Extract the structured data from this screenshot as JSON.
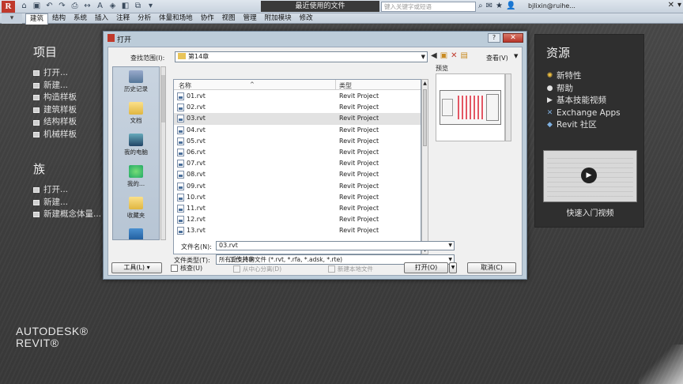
{
  "titlebar": {
    "doc_title": "最近使用的文件",
    "search_placeholder": "键入关键字或短语",
    "username": "bjlixin@ruihe..."
  },
  "ribbon": {
    "app_button": "▾",
    "tabs": [
      "建筑",
      "结构",
      "系统",
      "插入",
      "注释",
      "分析",
      "体量和场地",
      "协作",
      "视图",
      "管理",
      "附加模块",
      "修改"
    ]
  },
  "left": {
    "projects_title": "项目",
    "projects": [
      "打开...",
      "新建...",
      "构造样板",
      "建筑样板",
      "结构样板",
      "机械样板"
    ],
    "families_title": "族",
    "families": [
      "打开...",
      "新建...",
      "新建概念体量..."
    ],
    "brand_line1": "AUTODESK®",
    "brand_line2": "REVIT®"
  },
  "right": {
    "title": "资源",
    "items": [
      {
        "label": "新特性",
        "icon": "sun-icon"
      },
      {
        "label": "帮助",
        "icon": "help-icon"
      },
      {
        "label": "基本技能视频",
        "icon": "video-icon"
      },
      {
        "label": "Exchange Apps",
        "icon": "exchange-icon"
      },
      {
        "label": "Revit 社区",
        "icon": "community-icon"
      }
    ],
    "video_label": "快速入门视频"
  },
  "dialog": {
    "title": "打开",
    "help": "?",
    "look_in_label": "查找范围(I):",
    "look_in_value": "第14章",
    "view_label": "查看(V)",
    "places": [
      "历史记录",
      "文档",
      "我的电脑",
      "我的...",
      "收藏夹"
    ],
    "col_name": "名称",
    "col_type": "类型",
    "files": [
      {
        "name": "01.rvt",
        "type": "Revit Project"
      },
      {
        "name": "02.rvt",
        "type": "Revit Project"
      },
      {
        "name": "03.rvt",
        "type": "Revit Project"
      },
      {
        "name": "04.rvt",
        "type": "Revit Project"
      },
      {
        "name": "05.rvt",
        "type": "Revit Project"
      },
      {
        "name": "06.rvt",
        "type": "Revit Project"
      },
      {
        "name": "07.rvt",
        "type": "Revit Project"
      },
      {
        "name": "08.rvt",
        "type": "Revit Project"
      },
      {
        "name": "09.rvt",
        "type": "Revit Project"
      },
      {
        "name": "10.rvt",
        "type": "Revit Project"
      },
      {
        "name": "11.rvt",
        "type": "Revit Project"
      },
      {
        "name": "12.rvt",
        "type": "Revit Project"
      },
      {
        "name": "13.rvt",
        "type": "Revit Project"
      }
    ],
    "selected_index": 2,
    "preview_label": "预览",
    "filename_label": "文件名(N):",
    "filename_value": "03.rvt",
    "filetype_label": "文件类型(T):",
    "filetype_value": "所有受支持的文件 (*.rvt, *.rfa, *.adsk, *.rte)",
    "tools_label": "工具(L)",
    "verify_label": "核查(U)",
    "worksharing_title": "工作共享",
    "detach_label": "从中心分离(D)",
    "create_local_label": "新建本地文件",
    "open_label": "打开(O)",
    "cancel_label": "取消(C)"
  }
}
